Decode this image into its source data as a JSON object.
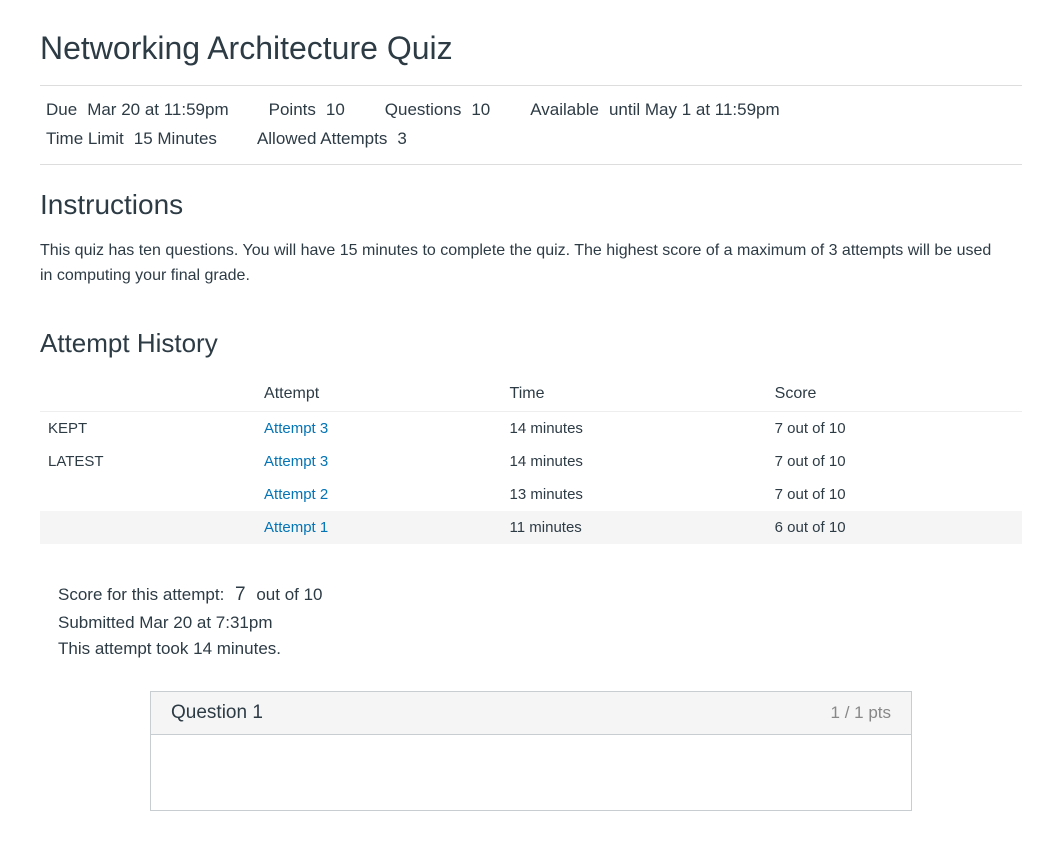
{
  "quiz": {
    "title": "Networking Architecture Quiz"
  },
  "meta": {
    "due_label": "Due",
    "due_value": "Mar 20 at 11:59pm",
    "points_label": "Points",
    "points_value": "10",
    "questions_label": "Questions",
    "questions_value": "10",
    "available_label": "Available",
    "available_value": "until May 1 at 11:59pm",
    "timelimit_label": "Time Limit",
    "timelimit_value": "15 Minutes",
    "allowed_label": "Allowed Attempts",
    "allowed_value": "3"
  },
  "instructions": {
    "heading": "Instructions",
    "body": "This quiz has ten questions. You will have 15 minutes to complete the quiz. The highest score of a maximum of 3 attempts will be used in computing your final grade."
  },
  "history": {
    "heading": "Attempt History",
    "columns": {
      "badge": "",
      "attempt": "Attempt",
      "time": "Time",
      "score": "Score"
    },
    "rows": [
      {
        "badge": "KEPT",
        "attempt": "Attempt 3",
        "time": "14 minutes",
        "score": "7 out of 10",
        "highlight": false
      },
      {
        "badge": "LATEST",
        "attempt": "Attempt 3",
        "time": "14 minutes",
        "score": "7 out of 10",
        "highlight": false
      },
      {
        "badge": "",
        "attempt": "Attempt 2",
        "time": "13 minutes",
        "score": "7 out of 10",
        "highlight": false
      },
      {
        "badge": "",
        "attempt": "Attempt 1",
        "time": "11 minutes",
        "score": "6 out of 10",
        "highlight": true
      }
    ]
  },
  "summary": {
    "score_label": "Score for this attempt:",
    "score_value": "7",
    "score_suffix": "out of 10",
    "submitted": "Submitted Mar 20 at 7:31pm",
    "duration": "This attempt took 14 minutes."
  },
  "question": {
    "title": "Question 1",
    "pts": "1 / 1 pts"
  }
}
